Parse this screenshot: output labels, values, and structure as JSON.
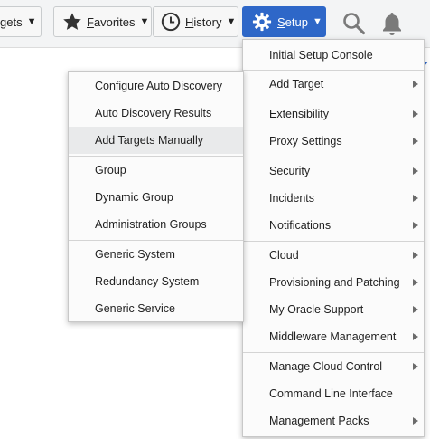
{
  "toolbar": {
    "targets_label": "gets",
    "favorites_label_first": "F",
    "favorites_label_rest": "avorites",
    "history_label_first": "H",
    "history_label_rest": "istory",
    "setup_label_first": "S",
    "setup_label_rest": "etup",
    "caret": "▼"
  },
  "setup_menu": {
    "items": [
      {
        "label": "Initial Setup Console",
        "has_submenu": false
      },
      {
        "label": "Add Target",
        "has_submenu": true
      },
      {
        "label": "Extensibility",
        "has_submenu": true
      },
      {
        "label": "Proxy Settings",
        "has_submenu": true
      },
      {
        "label": "Security",
        "has_submenu": true
      },
      {
        "label": "Incidents",
        "has_submenu": true
      },
      {
        "label": "Notifications",
        "has_submenu": true
      },
      {
        "label": "Cloud",
        "has_submenu": true
      },
      {
        "label": "Provisioning and Patching",
        "has_submenu": true
      },
      {
        "label": "My Oracle Support",
        "has_submenu": true
      },
      {
        "label": "Middleware Management",
        "has_submenu": true
      },
      {
        "label": "Manage Cloud Control",
        "has_submenu": true
      },
      {
        "label": "Command Line Interface",
        "has_submenu": false
      },
      {
        "label": "Management Packs",
        "has_submenu": true
      }
    ]
  },
  "add_target_submenu": {
    "items": [
      {
        "label": "Configure Auto Discovery"
      },
      {
        "label": "Auto Discovery Results"
      },
      {
        "label": "Add Targets Manually",
        "highlighted": true
      },
      {
        "label": "Group"
      },
      {
        "label": "Dynamic Group"
      },
      {
        "label": "Administration Groups"
      },
      {
        "label": "Generic System"
      },
      {
        "label": "Redundancy System"
      },
      {
        "label": "Generic Service"
      }
    ]
  },
  "icons": {
    "favorites": "star-icon",
    "history": "clock-icon",
    "setup": "gear-icon",
    "search": "search-icon",
    "notifications": "bell-icon"
  },
  "colors": {
    "setup_accent": "#2e67c8",
    "highlight": "#e9eaeb"
  }
}
